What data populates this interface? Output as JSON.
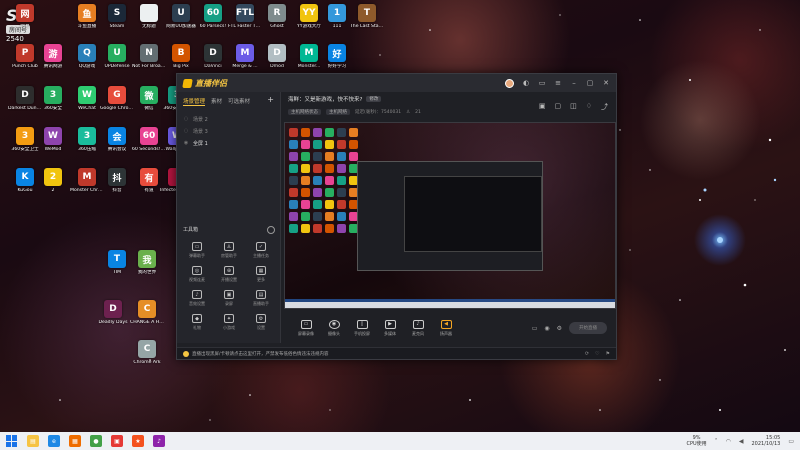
{
  "watermark": {
    "logo": "SH",
    "tag": "房间号",
    "number": "2540"
  },
  "desktop_icons": [
    {
      "label": "网易",
      "color": "#c0392b",
      "glyph": "网"
    },
    {
      "label": "斗鱼直播",
      "color": "#e67e22",
      "glyph": "鱼"
    },
    {
      "label": "Steam",
      "color": "#1b2838",
      "glyph": "S"
    },
    {
      "label": "无标题",
      "color": "#ecf0f1",
      "glyph": ""
    },
    {
      "label": "网易UU加速器",
      "color": "#2c3e50",
      "glyph": "U"
    },
    {
      "label": "60 Parsecs!",
      "color": "#16a085",
      "glyph": "60"
    },
    {
      "label": "FTL Faster Than Light",
      "color": "#34495e",
      "glyph": "FTL"
    },
    {
      "label": "Ghost",
      "color": "#7f8c8d",
      "glyph": "R"
    },
    {
      "label": "YY游戏大厅",
      "color": "#f1c40f",
      "glyph": "YY"
    },
    {
      "label": "111",
      "color": "#3498db",
      "glyph": "1"
    },
    {
      "label": "The Last Stand A...",
      "color": "#8e5a2b",
      "glyph": "T"
    },
    {
      "label": "Punch Club",
      "color": "#c0392b",
      "glyph": "P"
    },
    {
      "label": "腾讯网游",
      "color": "#e84393",
      "glyph": "游"
    },
    {
      "label": "QQ游戏",
      "color": "#2980b9",
      "glyph": "Q"
    },
    {
      "label": "UPDefense",
      "color": "#27ae60",
      "glyph": "U"
    },
    {
      "label": "Not For Broad...",
      "color": "#636e72",
      "glyph": "N"
    },
    {
      "label": "Big Pix",
      "color": "#d35400",
      "glyph": "B"
    },
    {
      "label": "DaVinci",
      "color": "#2d3436",
      "glyph": "D"
    },
    {
      "label": "Merge & ...",
      "color": "#6c5ce7",
      "glyph": "M"
    },
    {
      "label": "Dmod",
      "color": "#b2bec3",
      "glyph": "D"
    },
    {
      "label": "Monster...",
      "color": "#00b894",
      "glyph": "M"
    },
    {
      "label": "好好学习",
      "color": "#0984e3",
      "glyph": "好"
    },
    {
      "label": "Darkest Dungeon",
      "color": "#2d2d2d",
      "glyph": "D"
    },
    {
      "label": "360安全",
      "color": "#27ae60",
      "glyph": "3"
    },
    {
      "label": "WeChat",
      "color": "#2ecc71",
      "glyph": "W"
    },
    {
      "label": "Google Chrome",
      "color": "#e74c3c",
      "glyph": "G"
    },
    {
      "label": "微信",
      "color": "#27ae60",
      "glyph": "微"
    },
    {
      "label": "360安全卫士",
      "color": "#16a085",
      "glyph": "3"
    },
    {
      "label": "360安全卫士",
      "color": "#f39c12",
      "glyph": "3"
    },
    {
      "label": "WeMod",
      "color": "#8e44ad",
      "glyph": "W"
    },
    {
      "label": "360压缩",
      "color": "#1abc9c",
      "glyph": "3"
    },
    {
      "label": "腾讯会议",
      "color": "#0984e3",
      "glyph": "会"
    },
    {
      "label": "60 Seconds! Reatomized",
      "color": "#e84393",
      "glyph": "60"
    },
    {
      "label": "Wallpaper",
      "color": "#6c5ce7",
      "glyph": "W"
    },
    {
      "label": "KuGou",
      "color": "#0984e3",
      "glyph": "K"
    },
    {
      "label": "2",
      "color": "#f1c40f",
      "glyph": "2"
    },
    {
      "label": "Monster Chronic",
      "color": "#c0392b",
      "glyph": "M"
    },
    {
      "label": "抖音",
      "color": "#2d3436",
      "glyph": "抖"
    },
    {
      "label": "有道",
      "color": "#e74c3c",
      "glyph": "有"
    },
    {
      "label": "Infected Shelter",
      "color": "#b71540",
      "glyph": "I"
    },
    {
      "label": "Deadly Days",
      "color": "#6d214f",
      "glyph": "D"
    },
    {
      "label": "CHANGE A Homeless...",
      "color": "#e58e26",
      "glyph": "C"
    },
    {
      "label": "Chrome Ark",
      "color": "#95a5a6",
      "glyph": "C"
    },
    {
      "label": "TIM",
      "color": "#0984e3",
      "glyph": "T"
    },
    {
      "label": "我的世界",
      "color": "#6ab04c",
      "glyph": "我"
    }
  ],
  "app": {
    "name": "直播伴侣",
    "sidebar_tabs": [
      "场景管理",
      "素材",
      "可选素材"
    ],
    "scenes": [
      "场景 2",
      "场景 3",
      "全屏 1"
    ],
    "tools_title": "工具箱",
    "tools": [
      {
        "label": "弹幕助手",
        "glyph": "▭"
      },
      {
        "label": "房管助手",
        "glyph": "♙"
      },
      {
        "label": "主播任务",
        "glyph": "✓"
      },
      {
        "label": "视频连麦",
        "glyph": "◎"
      },
      {
        "label": "开播设置",
        "glyph": "⊕"
      },
      {
        "label": "更多",
        "glyph": "▦"
      },
      {
        "label": "音效设置",
        "glyph": "♪"
      },
      {
        "label": "录屏",
        "glyph": "▣"
      },
      {
        "label": "直播助手",
        "glyph": "▤"
      },
      {
        "label": "礼物",
        "glyph": "◆"
      },
      {
        "label": "小游戏",
        "glyph": "✦"
      },
      {
        "label": "设置",
        "glyph": "⚙"
      }
    ],
    "main_title": "海鲜：又是新游戏，快不快来?",
    "main_pill": "修改",
    "sub_chips": [
      "主机网络状态",
      "主机网络"
    ],
    "sub_text": "延迟(毫秒)：7540031",
    "sub_count": "21",
    "main_icons": [
      "▣",
      "▢",
      "◫",
      "♢",
      "⤴"
    ],
    "controls": [
      {
        "label": "屏幕录像",
        "glyph": "▭"
      },
      {
        "label": "摄像头",
        "glyph": "◉"
      },
      {
        "label": "手机投屏",
        "glyph": "▯"
      },
      {
        "label": "多媒体",
        "glyph": "▶"
      },
      {
        "label": "麦克风",
        "glyph": "♪"
      },
      {
        "label": "扬声器",
        "glyph": "◀"
      }
    ],
    "live_button": "开始直播",
    "notice": "直播出现黑屏/卡顿请点击这里打开，严禁发布低俗色情违法违规内容",
    "notice_right": [
      "⟳",
      "♡",
      "⚑"
    ]
  },
  "taskbar": {
    "apps": [
      {
        "name": "file-explorer",
        "color": "#f6c343",
        "glyph": "▤"
      },
      {
        "name": "edge",
        "color": "#1e88e5",
        "glyph": "e"
      },
      {
        "name": "app-3",
        "color": "#ef6c00",
        "glyph": "▦"
      },
      {
        "name": "chrome",
        "color": "#43a047",
        "glyph": "●"
      },
      {
        "name": "app-5",
        "color": "#e53935",
        "glyph": "▣"
      },
      {
        "name": "app-6",
        "color": "#f4511e",
        "glyph": "★"
      },
      {
        "name": "app-7",
        "color": "#8e24aa",
        "glyph": "♪"
      }
    ],
    "cpu_value": "9%",
    "cpu_label": "CPU使用",
    "time": "15:05",
    "date": "2021/10/13"
  }
}
